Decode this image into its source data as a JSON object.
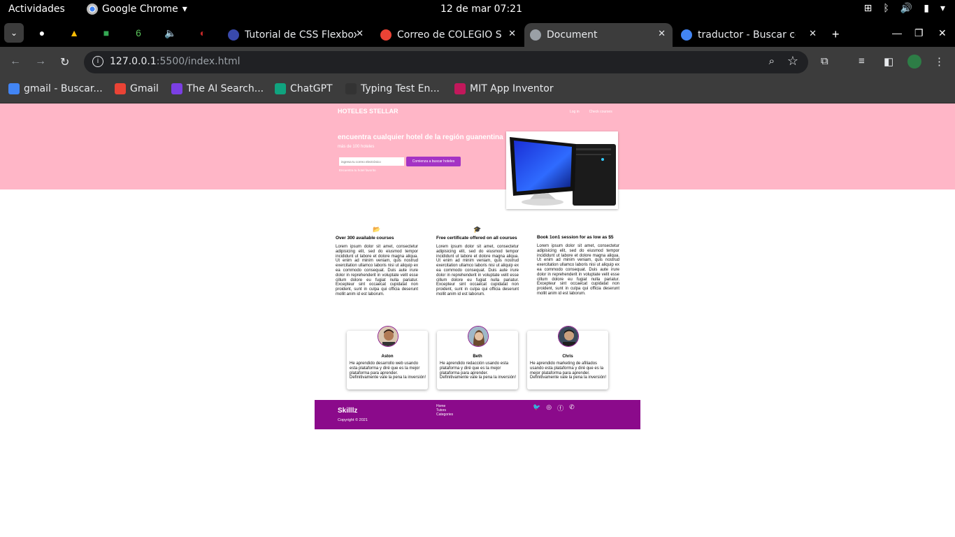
{
  "system_bar": {
    "activities": "Actividades",
    "app_name": "Google Chrome",
    "clock": "12 de mar  07:21"
  },
  "tabs": [
    {
      "title": "Tutorial de CSS Flexbox",
      "active": false
    },
    {
      "title": "Correo de COLEGIO S",
      "active": false
    },
    {
      "title": "Document",
      "active": true
    },
    {
      "title": "traductor - Buscar co",
      "active": false
    }
  ],
  "address": {
    "host": "127.0.0.1",
    "rest": ":5500/index.html"
  },
  "bookmarks": [
    {
      "label": "gmail - Buscar...",
      "color": "#4285f4"
    },
    {
      "label": "Gmail",
      "color": "#ea4335"
    },
    {
      "label": "The AI Search...",
      "color": "#7b3fe4"
    },
    {
      "label": "ChatGPT",
      "color": "#10a37f"
    },
    {
      "label": "Typing Test En...",
      "color": "#333333"
    },
    {
      "label": "MIT App Inventor",
      "color": "#c2185b"
    }
  ],
  "page": {
    "brand": "HOTELES STELLAR",
    "nav": [
      "Log in",
      "Check courses"
    ],
    "hero_title": "encuentra cualquier hotel de la región guanentina",
    "hero_subtitle": "más de 100 hoteles",
    "email_placeholder": "ingresa tu correo electrónico",
    "cta": "Comienza a buscar hoteles",
    "hint": "Encuentra tu hotel favorito",
    "features": [
      {
        "icon": "folder-open-icon",
        "title": "Over 300 available courses",
        "text": "Lorem ipsum dolor sit amet, consectetur adipisicing elit, sed do eiusmod tempor incididunt ut labore et dolore magna aliqua. Ut enim ad minim veniam, quis nostrud exercitation ullamco laboris nisi ut aliquip ex ea commodo consequat. Duis aute irure dolor in reprehenderit in voluptate velit esse cillum dolore eu fugiat nulla pariatur. Excepteur sint occaecat cupidatat non proident, sunt in culpa qui officia deserunt mollit anim id est laborum."
      },
      {
        "icon": "graduation-cap-icon",
        "title": "Free certificate offered on all courses",
        "text": "Lorem ipsum dolor sit amet, consectetur adipisicing elit, sed do eiusmod tempor incididunt ut labore et dolore magna aliqua. Ut enim ad minim veniam, quis nostrud exercitation ullamco laboris nisi ut aliquip ex ea commodo consequat. Duis aute irure dolor in reprehenderit in voluptate velit esse cillum dolore eu fugiat nulla pariatur. Excepteur sint occaecat cupidatat non proident, sunt in culpa qui officia deserunt mollit anim id est laborum."
      },
      {
        "icon": "",
        "title": "Book 1on1 session for as low as $5",
        "text": "Lorem ipsum dolor sit amet, consectetur adipisicing elit, sed do eiusmod tempor incididunt ut labore et dolore magna aliqua. Ut enim ad minim veniam, quis nostrud exercitation ullamco laboris nisi ut aliquip ex ea commodo consequat. Duis aute irure dolor in reprehenderit in voluptate velit esse cillum dolore eu fugiat nulla pariatur. Excepteur sint occaecat cupidatat non proident, sunt in culpa qui officia deserunt mollit anim id est laborum."
      }
    ],
    "testimonials": [
      {
        "name": "Aston",
        "quote": "He aprendido desarrollo web usando esta plataforma y diré que es la mejor plataforma para aprender. Definitivamente vale la pena la inversión!"
      },
      {
        "name": "Beth",
        "quote": "He aprendido redacción usando esta plataforma y diré que es la mejor plataforma para aprender. Definitivamente vale la pena la inversión!"
      },
      {
        "name": "Chris",
        "quote": "He aprendido marketing de afiliados usando esta plataforma y diré que es la mejor plataforma para aprender. Definitivamente vale la pena la inversión!"
      }
    ],
    "footer": {
      "brand": "Skilllz",
      "copyright": "Copyright © 2021",
      "links": [
        "Home",
        "Tutors",
        "Categories"
      ],
      "social": [
        "twitter-icon",
        "instagram-icon",
        "facebook-icon",
        "whatsapp-icon"
      ]
    }
  },
  "colors": {
    "hero_bg": "#ffb6c7",
    "cta": "#a433c4",
    "footer_bg": "#8b0a8b"
  }
}
